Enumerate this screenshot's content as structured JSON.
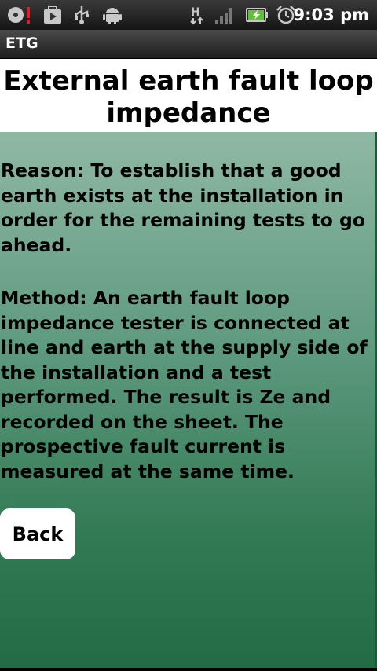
{
  "status_bar": {
    "time": "9:03 pm",
    "icons": [
      "cd-alert-icon",
      "play-store-icon",
      "usb-icon",
      "android-debug-icon",
      "hspa-signal-icon",
      "signal-bars-icon",
      "battery-charging-icon",
      "alarm-clock-icon"
    ],
    "network_label": "H"
  },
  "app": {
    "title": "ETG"
  },
  "header": {
    "title": "External earth fault loop impedance"
  },
  "content": {
    "reason": "Reason: To establish that a good earth exists at the installation in order for the remaining tests to go ahead.",
    "method": "Method: An earth fault loop impedance tester is connected at line and earth at the supply side of the installation and a test performed. The result is Ze and recorded on the sheet. The prospective fault current is measured at the same time."
  },
  "actions": {
    "back_label": "Back"
  },
  "colors": {
    "gradient_top": "#8fb8a4",
    "gradient_bottom": "#226b45"
  }
}
